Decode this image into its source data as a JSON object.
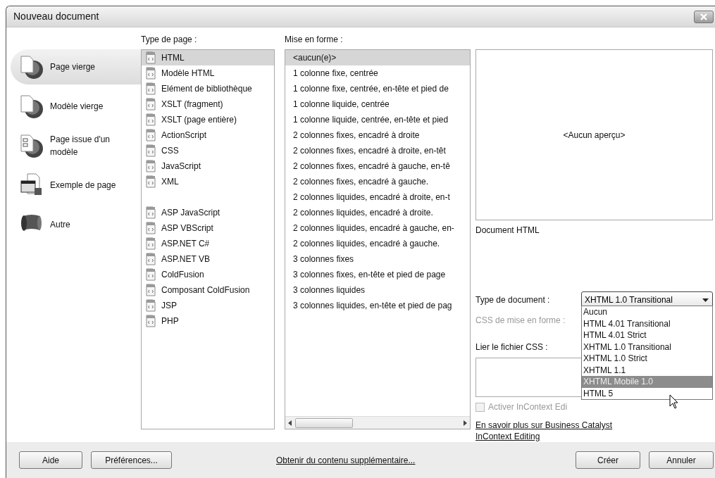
{
  "window": {
    "title": "Nouveau document"
  },
  "categories": [
    {
      "label": "Page vierge",
      "kind": "blank",
      "selected": true
    },
    {
      "label": "Modèle vierge",
      "kind": "blank",
      "selected": false
    },
    {
      "label": "Page issue d'un modèle",
      "kind": "template",
      "selected": false
    },
    {
      "label": "Exemple de page",
      "kind": "sample",
      "selected": false
    },
    {
      "label": "Autre",
      "kind": "other",
      "selected": false
    }
  ],
  "page_type": {
    "label": "Type de page :",
    "groups": [
      [
        {
          "label": "HTML",
          "selected": true
        },
        {
          "label": "Modèle HTML",
          "selected": false
        },
        {
          "label": "Elément de bibliothèque",
          "selected": false
        },
        {
          "label": "XSLT (fragment)",
          "selected": false
        },
        {
          "label": "XSLT (page entière)",
          "selected": false
        },
        {
          "label": "ActionScript",
          "selected": false
        },
        {
          "label": "CSS",
          "selected": false
        },
        {
          "label": "JavaScript",
          "selected": false
        },
        {
          "label": "XML",
          "selected": false
        }
      ],
      [
        {
          "label": "ASP JavaScript",
          "selected": false
        },
        {
          "label": "ASP VBScript",
          "selected": false
        },
        {
          "label": "ASP.NET C#",
          "selected": false
        },
        {
          "label": "ASP.NET VB",
          "selected": false
        },
        {
          "label": "ColdFusion",
          "selected": false
        },
        {
          "label": "Composant ColdFusion",
          "selected": false
        },
        {
          "label": "JSP",
          "selected": false
        },
        {
          "label": "PHP",
          "selected": false
        }
      ]
    ]
  },
  "layout": {
    "label": "Mise en forme :",
    "items": [
      {
        "label": "<aucun(e)>",
        "selected": true
      },
      {
        "label": "1 colonne fixe, centrée",
        "selected": false
      },
      {
        "label": "1 colonne fixe, centrée, en-tête et pied de",
        "selected": false
      },
      {
        "label": "1 colonne liquide, centrée",
        "selected": false
      },
      {
        "label": "1 colonne liquide, centrée, en-tête et pied",
        "selected": false
      },
      {
        "label": "2 colonnes fixes, encadré à droite",
        "selected": false
      },
      {
        "label": "2 colonnes fixes, encadré à droite, en-têt",
        "selected": false
      },
      {
        "label": "2 colonnes fixes, encadré à gauche, en-tê",
        "selected": false
      },
      {
        "label": "2 colonnes fixes, encadré à gauche.",
        "selected": false
      },
      {
        "label": "2 colonnes liquides, encadré à droite, en-t",
        "selected": false
      },
      {
        "label": "2 colonnes liquides, encadré à droite.",
        "selected": false
      },
      {
        "label": "2 colonnes liquides, encadré à gauche, en-",
        "selected": false
      },
      {
        "label": "2 colonnes liquides, encadré à gauche.",
        "selected": false
      },
      {
        "label": "3 colonnes fixes",
        "selected": false
      },
      {
        "label": "3 colonnes fixes, en-tête et pied de page",
        "selected": false
      },
      {
        "label": "3 colonnes liquides",
        "selected": false
      },
      {
        "label": "3 colonnes liquides, en-tête et pied de pag",
        "selected": false
      }
    ]
  },
  "preview": {
    "text": "<Aucun aperçu>",
    "caption": "Document HTML"
  },
  "doc_type": {
    "label": "Type de document :",
    "value": "XHTML 1.0 Transitional",
    "expanded": true,
    "options": [
      {
        "label": "Aucun",
        "highlighted": false
      },
      {
        "label": "HTML 4.01 Transitional",
        "highlighted": false
      },
      {
        "label": "HTML 4.01 Strict",
        "highlighted": false
      },
      {
        "label": "XHTML 1.0 Transitional",
        "highlighted": false
      },
      {
        "label": "XHTML 1.0 Strict",
        "highlighted": false
      },
      {
        "label": "XHTML 1.1",
        "highlighted": false
      },
      {
        "label": "XHTML Mobile 1.0",
        "highlighted": true
      },
      {
        "label": "HTML 5",
        "highlighted": false
      }
    ]
  },
  "css_layout": {
    "label": "CSS de mise en forme :",
    "disabled": true
  },
  "link_css": {
    "label": "Lier le fichier CSS :"
  },
  "incontext": {
    "label": "Activer InContext Edi",
    "checked": false,
    "disabled": true
  },
  "learn_more": "En savoir plus sur Business Catalyst InContext Editing",
  "footer": {
    "left_buttons": [
      "Aide",
      "Préférences..."
    ],
    "link": "Obtenir du contenu supplémentaire...",
    "right_buttons": [
      "Créer",
      "Annuler"
    ]
  }
}
